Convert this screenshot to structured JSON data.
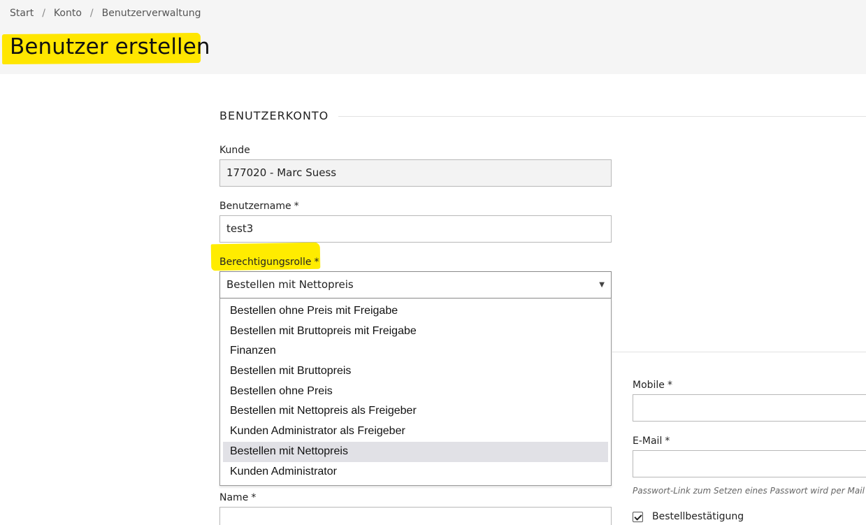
{
  "breadcrumb": {
    "items": [
      "Start",
      "Konto",
      "Benutzerverwaltung"
    ],
    "separator": "/"
  },
  "page": {
    "title": "Benutzer erstellen",
    "highlight_color": "#ffe600"
  },
  "account_section": {
    "title": "BENUTZERKONTO"
  },
  "fields": {
    "kunde": {
      "label": "Kunde",
      "value": "177020 - Marc Suess"
    },
    "benutzername": {
      "label": "Benutzername",
      "required": "*",
      "value": "test3"
    },
    "rolle": {
      "label": "Berechtigungsrolle",
      "required": "*",
      "value": "Bestellen mit Nettopreis",
      "arrow": "▼",
      "options": [
        "Bestellen ohne Preis mit Freigabe",
        "Bestellen mit Bruttopreis mit Freigabe",
        "Finanzen",
        "Bestellen mit Bruttopreis",
        "Bestellen ohne Preis",
        "Bestellen mit Nettopreis als Freigeber",
        "Kunden Administrator als Freigeber",
        "Bestellen mit Nettopreis",
        "Kunden Administrator"
      ],
      "selected_index": 7
    },
    "name": {
      "label": "Name",
      "required": "*",
      "value": ""
    },
    "mobile": {
      "label": "Mobile",
      "required": "*",
      "value": ""
    },
    "email": {
      "label": "E-Mail",
      "required": "*",
      "value": ""
    }
  },
  "hint": "Passwort-Link zum Setzen eines Passwort wird per Mail",
  "checkbox": {
    "label": "Bestellbestätigung",
    "checked": true
  }
}
